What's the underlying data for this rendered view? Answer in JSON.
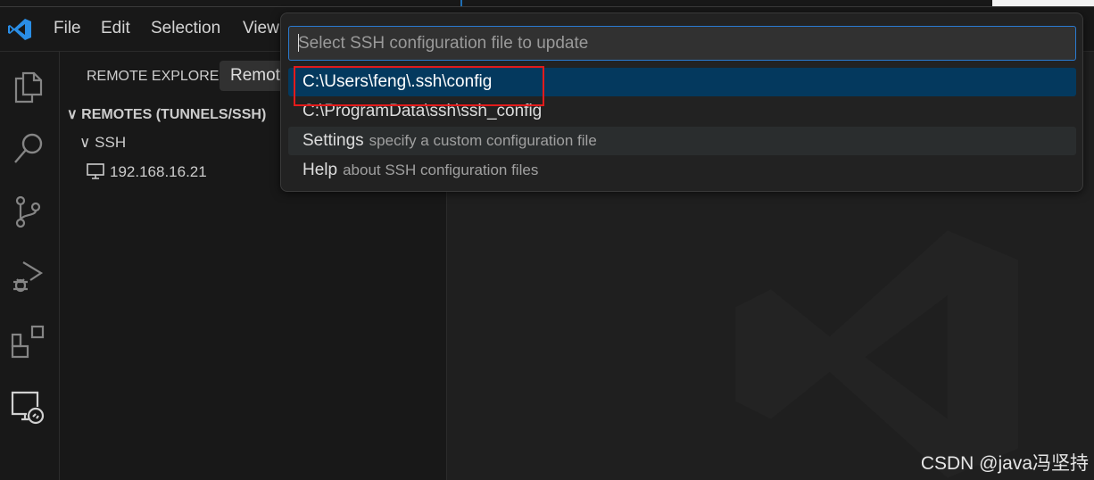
{
  "menu": [
    "File",
    "Edit",
    "Selection",
    "View"
  ],
  "activity_bar": [
    "explorer-icon",
    "search-icon",
    "source-control-icon",
    "run-debug-icon",
    "extensions-icon",
    "remote-explorer-icon"
  ],
  "sidebar": {
    "title": "REMOTE EXPLORER",
    "dropdown_value": "Remote",
    "section": "REMOTES (TUNNELS/SSH)",
    "group": "SSH",
    "host": "192.168.16.21"
  },
  "quick_pick": {
    "placeholder": "Select SSH configuration file to update",
    "items": [
      {
        "label": "C:\\Users\\feng\\.ssh\\config",
        "desc": ""
      },
      {
        "label": "C:\\ProgramData\\ssh\\ssh_config",
        "desc": ""
      },
      {
        "label": "Settings",
        "desc": "specify a custom configuration file"
      },
      {
        "label": "Help",
        "desc": "about SSH configuration files"
      }
    ]
  },
  "watermark": "CSDN @java冯坚持",
  "colors": {
    "accent": "#2a7ad0",
    "selected": "#04395e",
    "highlight_box": "#e31b1b"
  }
}
